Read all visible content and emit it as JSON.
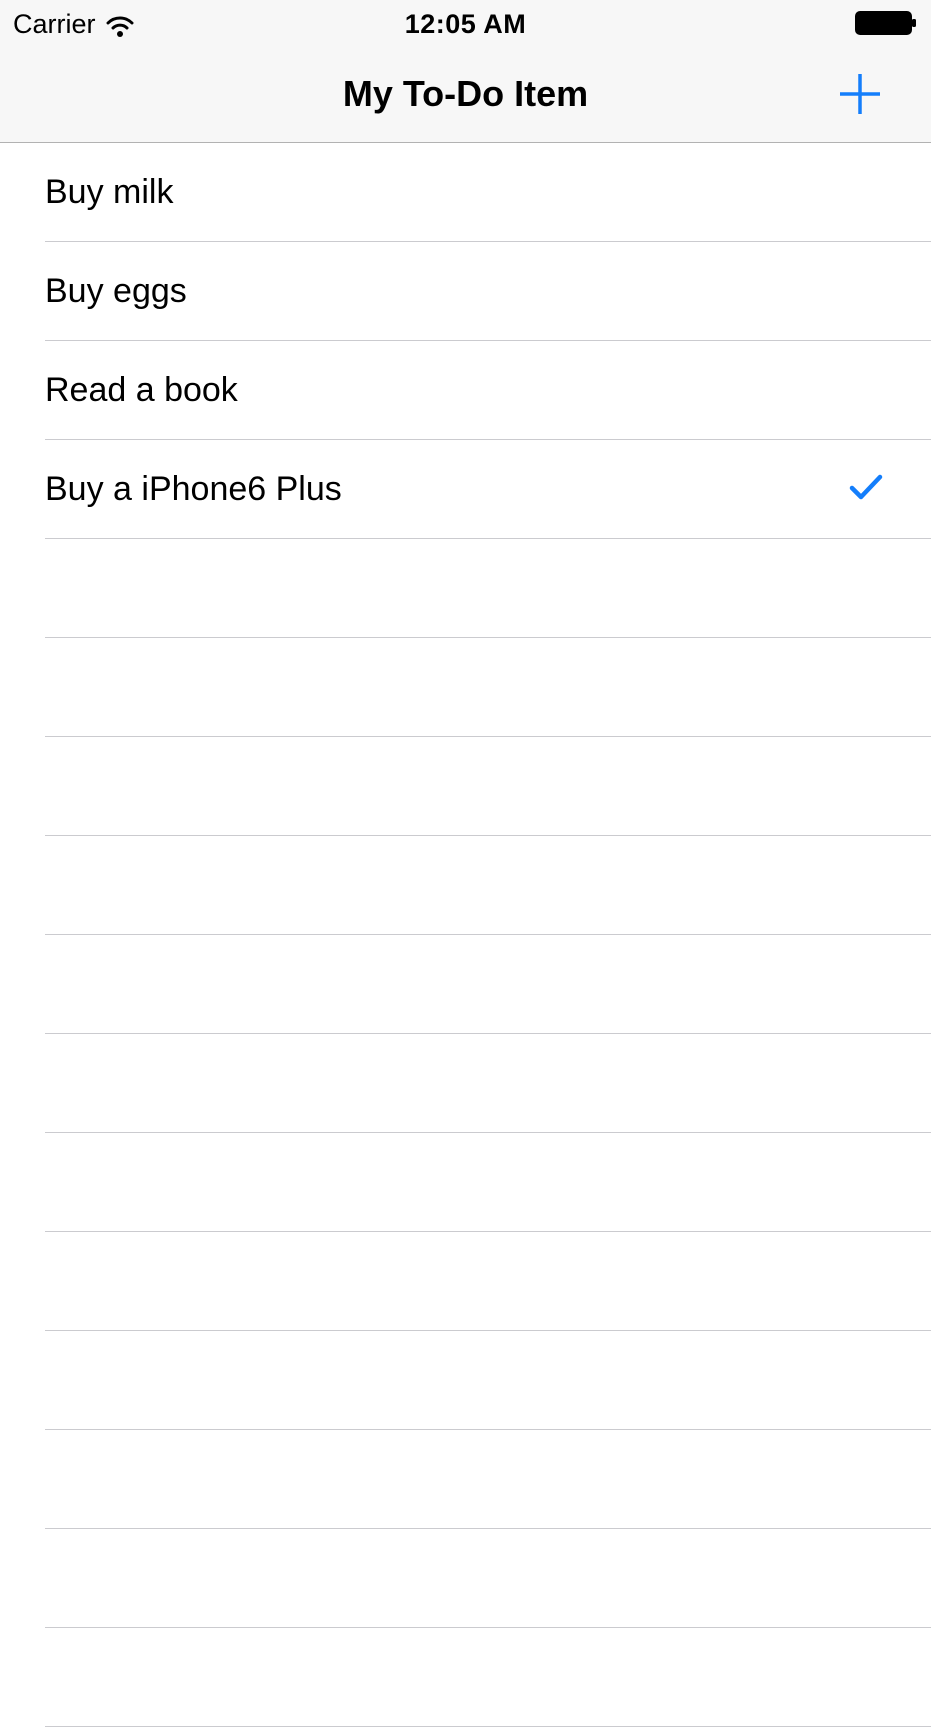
{
  "status_bar": {
    "carrier": "Carrier",
    "time": "12:05 AM",
    "wifi_icon": "wifi-icon",
    "battery_icon": "battery-full-icon"
  },
  "nav_bar": {
    "title": "My To-Do Item",
    "add_icon": "plus-icon"
  },
  "colors": {
    "accent": "#147EFB",
    "separator": "#CBCBCF",
    "nav_background": "#F7F7F7"
  },
  "items": [
    {
      "label": "Buy milk",
      "completed": false
    },
    {
      "label": "Buy eggs",
      "completed": false
    },
    {
      "label": "Read a book",
      "completed": false
    },
    {
      "label": "Buy a iPhone6 Plus",
      "completed": true
    }
  ]
}
